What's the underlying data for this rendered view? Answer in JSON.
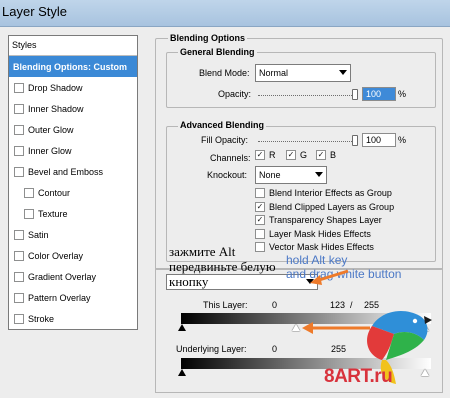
{
  "window": {
    "title": "Layer Style"
  },
  "styles_panel": {
    "header": "Styles",
    "items": [
      {
        "label": "Blending Options: Custom",
        "checkbox": false,
        "selected": true,
        "indent": false
      },
      {
        "label": "Drop Shadow",
        "checkbox": true,
        "checked": false,
        "indent": false
      },
      {
        "label": "Inner Shadow",
        "checkbox": true,
        "checked": false,
        "indent": false
      },
      {
        "label": "Outer Glow",
        "checkbox": true,
        "checked": false,
        "indent": false
      },
      {
        "label": "Inner Glow",
        "checkbox": true,
        "checked": false,
        "indent": false
      },
      {
        "label": "Bevel and Emboss",
        "checkbox": true,
        "checked": false,
        "indent": false
      },
      {
        "label": "Contour",
        "checkbox": true,
        "checked": false,
        "indent": true
      },
      {
        "label": "Texture",
        "checkbox": true,
        "checked": false,
        "indent": true
      },
      {
        "label": "Satin",
        "checkbox": true,
        "checked": false,
        "indent": false
      },
      {
        "label": "Color Overlay",
        "checkbox": true,
        "checked": false,
        "indent": false
      },
      {
        "label": "Gradient Overlay",
        "checkbox": true,
        "checked": false,
        "indent": false
      },
      {
        "label": "Pattern Overlay",
        "checkbox": true,
        "checked": false,
        "indent": false
      },
      {
        "label": "Stroke",
        "checkbox": true,
        "checked": false,
        "indent": false
      }
    ]
  },
  "blending_options": {
    "title": "Blending Options",
    "general": {
      "title": "General Blending",
      "blend_mode_label": "Blend Mode:",
      "blend_mode_value": "Normal",
      "opacity_label": "Opacity:",
      "opacity_value": "100",
      "opacity_unit": "%",
      "opacity_level": 1.0
    },
    "advanced": {
      "title": "Advanced Blending",
      "fill_opacity_label": "Fill Opacity:",
      "fill_opacity_value": "100",
      "fill_opacity_unit": "%",
      "fill_opacity_level": 1.0,
      "channels_label": "Channels:",
      "channels": [
        {
          "label": "R",
          "checked": true
        },
        {
          "label": "G",
          "checked": true
        },
        {
          "label": "B",
          "checked": true
        }
      ],
      "knockout_label": "Knockout:",
      "knockout_value": "None",
      "options": [
        {
          "label": "Blend Interior Effects as Group",
          "checked": false
        },
        {
          "label": "Blend Clipped Layers as Group",
          "checked": true
        },
        {
          "label": "Transparency Shapes Layer",
          "checked": true
        },
        {
          "label": "Layer Mask Hides Effects",
          "checked": false
        },
        {
          "label": "Vector Mask Hides Effects",
          "checked": false
        }
      ]
    },
    "blend_if": {
      "this_layer_label": "This Layer:",
      "this_layer_low": "0",
      "this_layer_split_low": "123",
      "this_layer_sep": "/",
      "this_layer_high": "255",
      "underlying_label": "Underlying Layer:",
      "underlying_low": "0",
      "underlying_high": "255"
    }
  },
  "annotations": {
    "russian": "зажмите Alt передвиньте белую кнопку",
    "english_line1": "hold Alt key",
    "english_line2": "and drag white button"
  },
  "watermark": {
    "text": "8ART.ru"
  },
  "colors": {
    "selection": "#3b89d6",
    "annotation_blue": "#4b78c6",
    "arrow_orange": "#ee7a2a",
    "brand_red": "#d8323c"
  }
}
